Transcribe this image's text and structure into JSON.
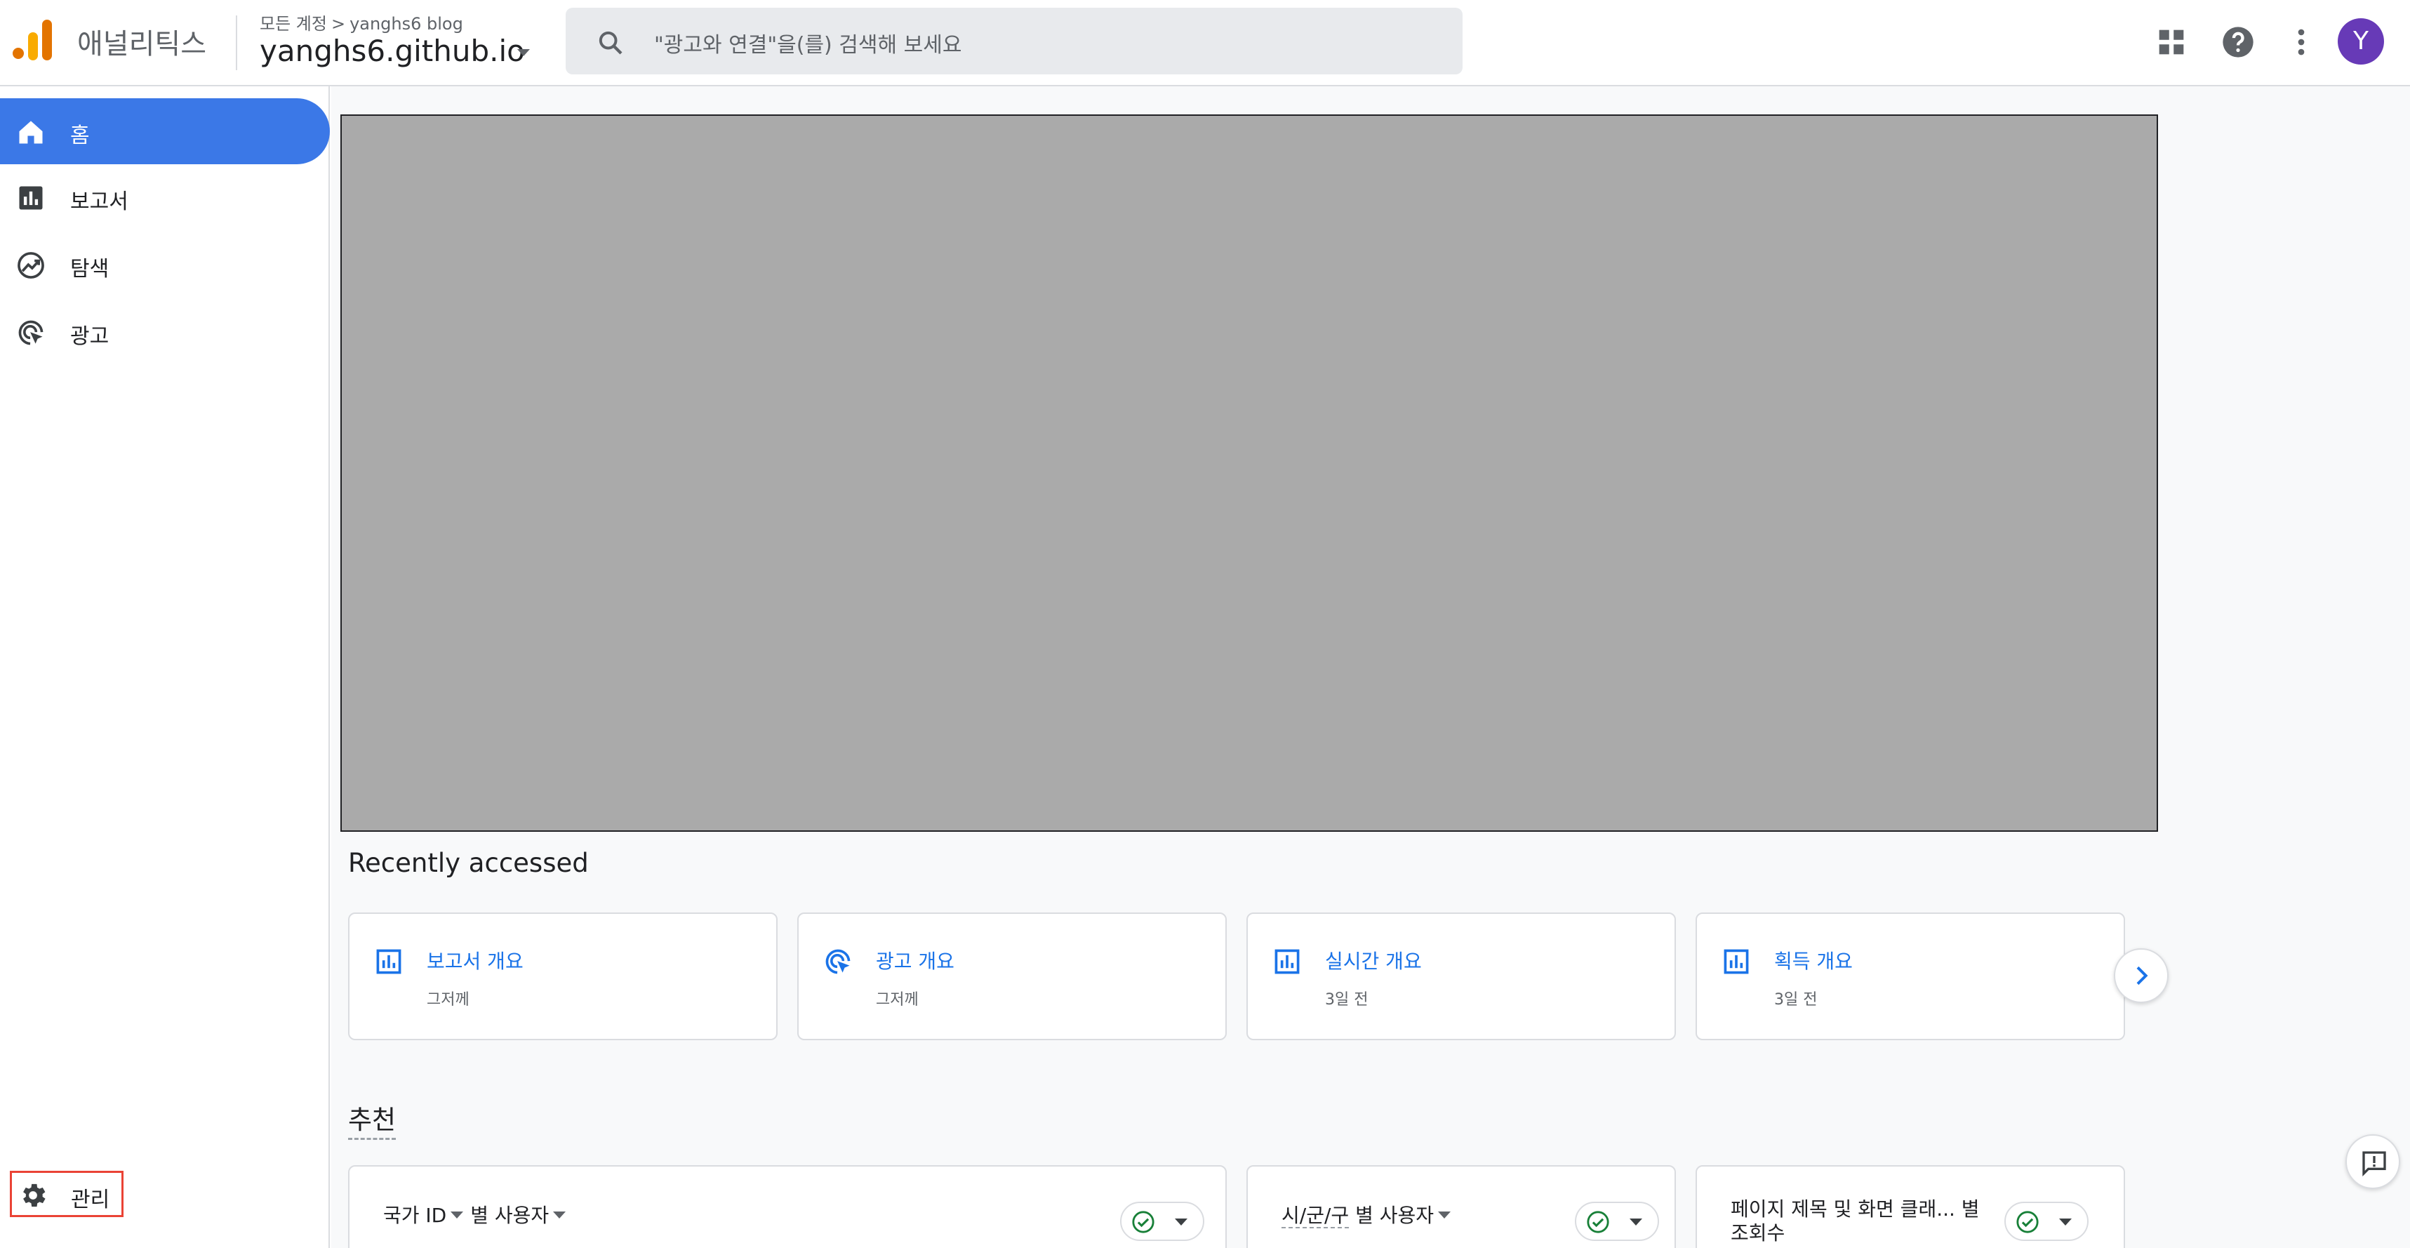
{
  "header": {
    "app_name": "애널리틱스",
    "breadcrumb": {
      "parent": "모든 계정",
      "separator": ">",
      "current": "yanghs6 blog"
    },
    "property": "yanghs6.github.io",
    "search_placeholder": "\"광고와 연결\"을(를) 검색해 보세요",
    "avatar_initial": "Y"
  },
  "sidebar": {
    "items": [
      {
        "label": "홈",
        "icon": "home-icon",
        "active": true
      },
      {
        "label": "보고서",
        "icon": "reports-icon"
      },
      {
        "label": "탐색",
        "icon": "explore-icon"
      },
      {
        "label": "광고",
        "icon": "advertising-icon"
      }
    ],
    "admin_label": "관리"
  },
  "main": {
    "recent_title": "Recently accessed",
    "recent_cards": [
      {
        "title": "보고서 개요",
        "subtitle": "그저께",
        "icon": "bar-chart-icon"
      },
      {
        "title": "광고 개요",
        "subtitle": "그저께",
        "icon": "advertising-icon"
      },
      {
        "title": "실시간 개요",
        "subtitle": "3일 전",
        "icon": "bar-chart-icon"
      },
      {
        "title": "획득 개요",
        "subtitle": "3일 전",
        "icon": "bar-chart-icon"
      }
    ],
    "reco_title": "추천",
    "reco_cards": [
      {
        "dim": "국가 ID",
        "metric": "별 사용자"
      },
      {
        "dim": "시/군/구",
        "metric": "별 사용자"
      },
      {
        "title": "페이지 제목 및 화면 클래... 별 조회수"
      }
    ]
  },
  "colors": {
    "accent": "#3b78e7",
    "link": "#1a73e8",
    "avatar": "#673ab7",
    "check": "#188038"
  }
}
